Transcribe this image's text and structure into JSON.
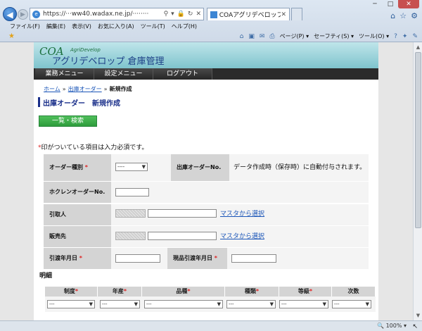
{
  "browser": {
    "url": "https://···ww40.wadax.ne.jp/···········",
    "tab_title": "COAアグリデベロップ 倉...",
    "menu": [
      "ファイル(F)",
      "編集(E)",
      "表示(V)",
      "お気に入り(A)",
      "ツール(T)",
      "ヘルプ(H)"
    ],
    "commands": [
      "ページ(P) ▾",
      "セーフティ(S) ▾",
      "ツール(O) ▾"
    ],
    "zoom": "100%",
    "window_buttons": [
      "─",
      "□",
      "✕"
    ]
  },
  "site": {
    "logo_coa": "COA",
    "logo_small": "AgriDevelop",
    "logo_main": "アグリデベロップ 倉庫管理",
    "nav": [
      "業務メニュー",
      "設定メニュー",
      "ログアウト"
    ]
  },
  "breadcrumb": {
    "home": "ホーム",
    "parent": "出庫オーダー",
    "current": "新規作成",
    "sep": "»"
  },
  "page_title": "出庫オーダー　新規作成",
  "list_button": "一覧・検索",
  "required_note": {
    "mark": "*",
    "text": "印がついている項目は入力必須です。"
  },
  "form": {
    "order_type_label": "オーダー種別",
    "order_type_value": "----",
    "order_no_label": "出庫オーダーNo.",
    "order_no_value": "データ作成時（保存時）に自動付与されます。",
    "hokuren_label": "ホクレンオーダーNo.",
    "pickup_label": "引取人",
    "seller_label": "販売先",
    "master_link": "マスタから選択",
    "pickup_date_label": "引渡年月日",
    "actual_date_label": "現品引渡年月日",
    "star": "*"
  },
  "detail": {
    "title": "明細",
    "columns": [
      {
        "label": "制度",
        "required": true
      },
      {
        "label": "年産",
        "required": true
      },
      {
        "label": "品種",
        "required": true
      },
      {
        "label": "種類",
        "required": true
      },
      {
        "label": "等級",
        "required": true
      },
      {
        "label": "次数",
        "required": false
      }
    ],
    "row_values": [
      "---",
      "---",
      "---",
      "---",
      "---",
      "---"
    ]
  },
  "colors": {
    "accent": "#1a2f8a",
    "button": "#2e9c3d",
    "link": "#1a55b8",
    "required": "#dd2222"
  }
}
